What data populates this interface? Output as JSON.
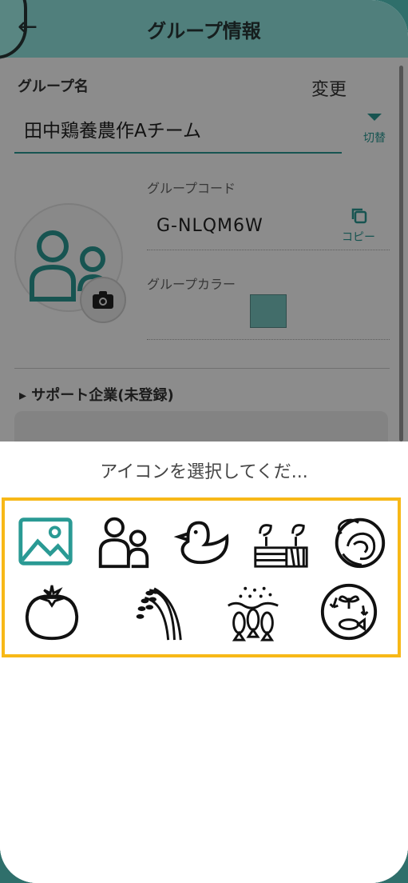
{
  "header": {
    "title": "グループ情報",
    "back_icon": "arrow-left-icon"
  },
  "group": {
    "name_label": "グループ名",
    "change_label": "変更",
    "name_value": "田中鶏養農作Aチーム",
    "switch_label": "切替",
    "code_label": "グループコード",
    "code_value": "G-NLQM6W",
    "copy_label": "コピー",
    "color_label": "グループカラー",
    "color_value": "#79c6c1"
  },
  "support": {
    "label": "▸ サポート企業(未登録)"
  },
  "icon_picker": {
    "title": "アイコンを選択してくだ...",
    "border_color": "#f7b817",
    "icons": [
      "image-icon",
      "people-icon",
      "chick-icon",
      "sprout-field-icon",
      "cabbage-icon",
      "tomato-icon",
      "rice-icon",
      "fish-school-icon",
      "aquaponics-icon"
    ]
  },
  "accent_color": "#2a9a94"
}
